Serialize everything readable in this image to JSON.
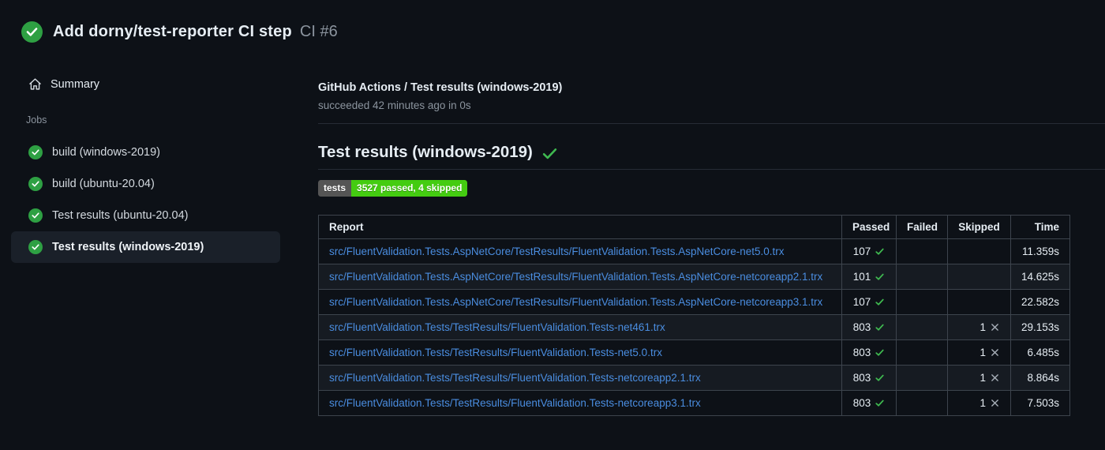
{
  "colors": {
    "page_bg": "#0d1117",
    "success_green": "#2ea043",
    "check_green": "#3fb950",
    "link_blue": "#4a8de0",
    "muted": "#8b949e",
    "badge_label_bg": "#555555",
    "badge_value_bg": "#44cc11",
    "table_border": "#3d444d",
    "row_alt_bg": "#161b22",
    "selected_item_bg": "#1a2029"
  },
  "header": {
    "title": "Add dorny/test-reporter CI step",
    "run_label": "CI #6",
    "status": "success"
  },
  "sidebar": {
    "summary_label": "Summary",
    "jobs_section_label": "Jobs",
    "jobs": [
      {
        "label": "build (windows-2019)",
        "status": "success",
        "selected": false
      },
      {
        "label": "build (ubuntu-20.04)",
        "status": "success",
        "selected": false
      },
      {
        "label": "Test results (ubuntu-20.04)",
        "status": "success",
        "selected": false
      },
      {
        "label": "Test results (windows-2019)",
        "status": "success",
        "selected": true
      }
    ]
  },
  "main": {
    "job_title": "GitHub Actions / Test results (windows-2019)",
    "job_status_line": "succeeded 42 minutes ago in 0s",
    "section_heading": "Test results (windows-2019)",
    "section_status": "success",
    "badge": {
      "label": "tests",
      "value": "3527 passed, 4 skipped"
    },
    "table": {
      "columns": [
        "Report",
        "Passed",
        "Failed",
        "Skipped",
        "Time"
      ],
      "rows": [
        {
          "report": "src/FluentValidation.Tests.AspNetCore/TestResults/FluentValidation.Tests.AspNetCore-net5.0.trx",
          "passed": "107",
          "failed": "",
          "skipped": "",
          "time": "11.359s"
        },
        {
          "report": "src/FluentValidation.Tests.AspNetCore/TestResults/FluentValidation.Tests.AspNetCore-netcoreapp2.1.trx",
          "passed": "101",
          "failed": "",
          "skipped": "",
          "time": "14.625s"
        },
        {
          "report": "src/FluentValidation.Tests.AspNetCore/TestResults/FluentValidation.Tests.AspNetCore-netcoreapp3.1.trx",
          "passed": "107",
          "failed": "",
          "skipped": "",
          "time": "22.582s"
        },
        {
          "report": "src/FluentValidation.Tests/TestResults/FluentValidation.Tests-net461.trx",
          "passed": "803",
          "failed": "",
          "skipped": "1",
          "time": "29.153s"
        },
        {
          "report": "src/FluentValidation.Tests/TestResults/FluentValidation.Tests-net5.0.trx",
          "passed": "803",
          "failed": "",
          "skipped": "1",
          "time": "6.485s"
        },
        {
          "report": "src/FluentValidation.Tests/TestResults/FluentValidation.Tests-netcoreapp2.1.trx",
          "passed": "803",
          "failed": "",
          "skipped": "1",
          "time": "8.864s"
        },
        {
          "report": "src/FluentValidation.Tests/TestResults/FluentValidation.Tests-netcoreapp3.1.trx",
          "passed": "803",
          "failed": "",
          "skipped": "1",
          "time": "7.503s"
        }
      ]
    }
  }
}
